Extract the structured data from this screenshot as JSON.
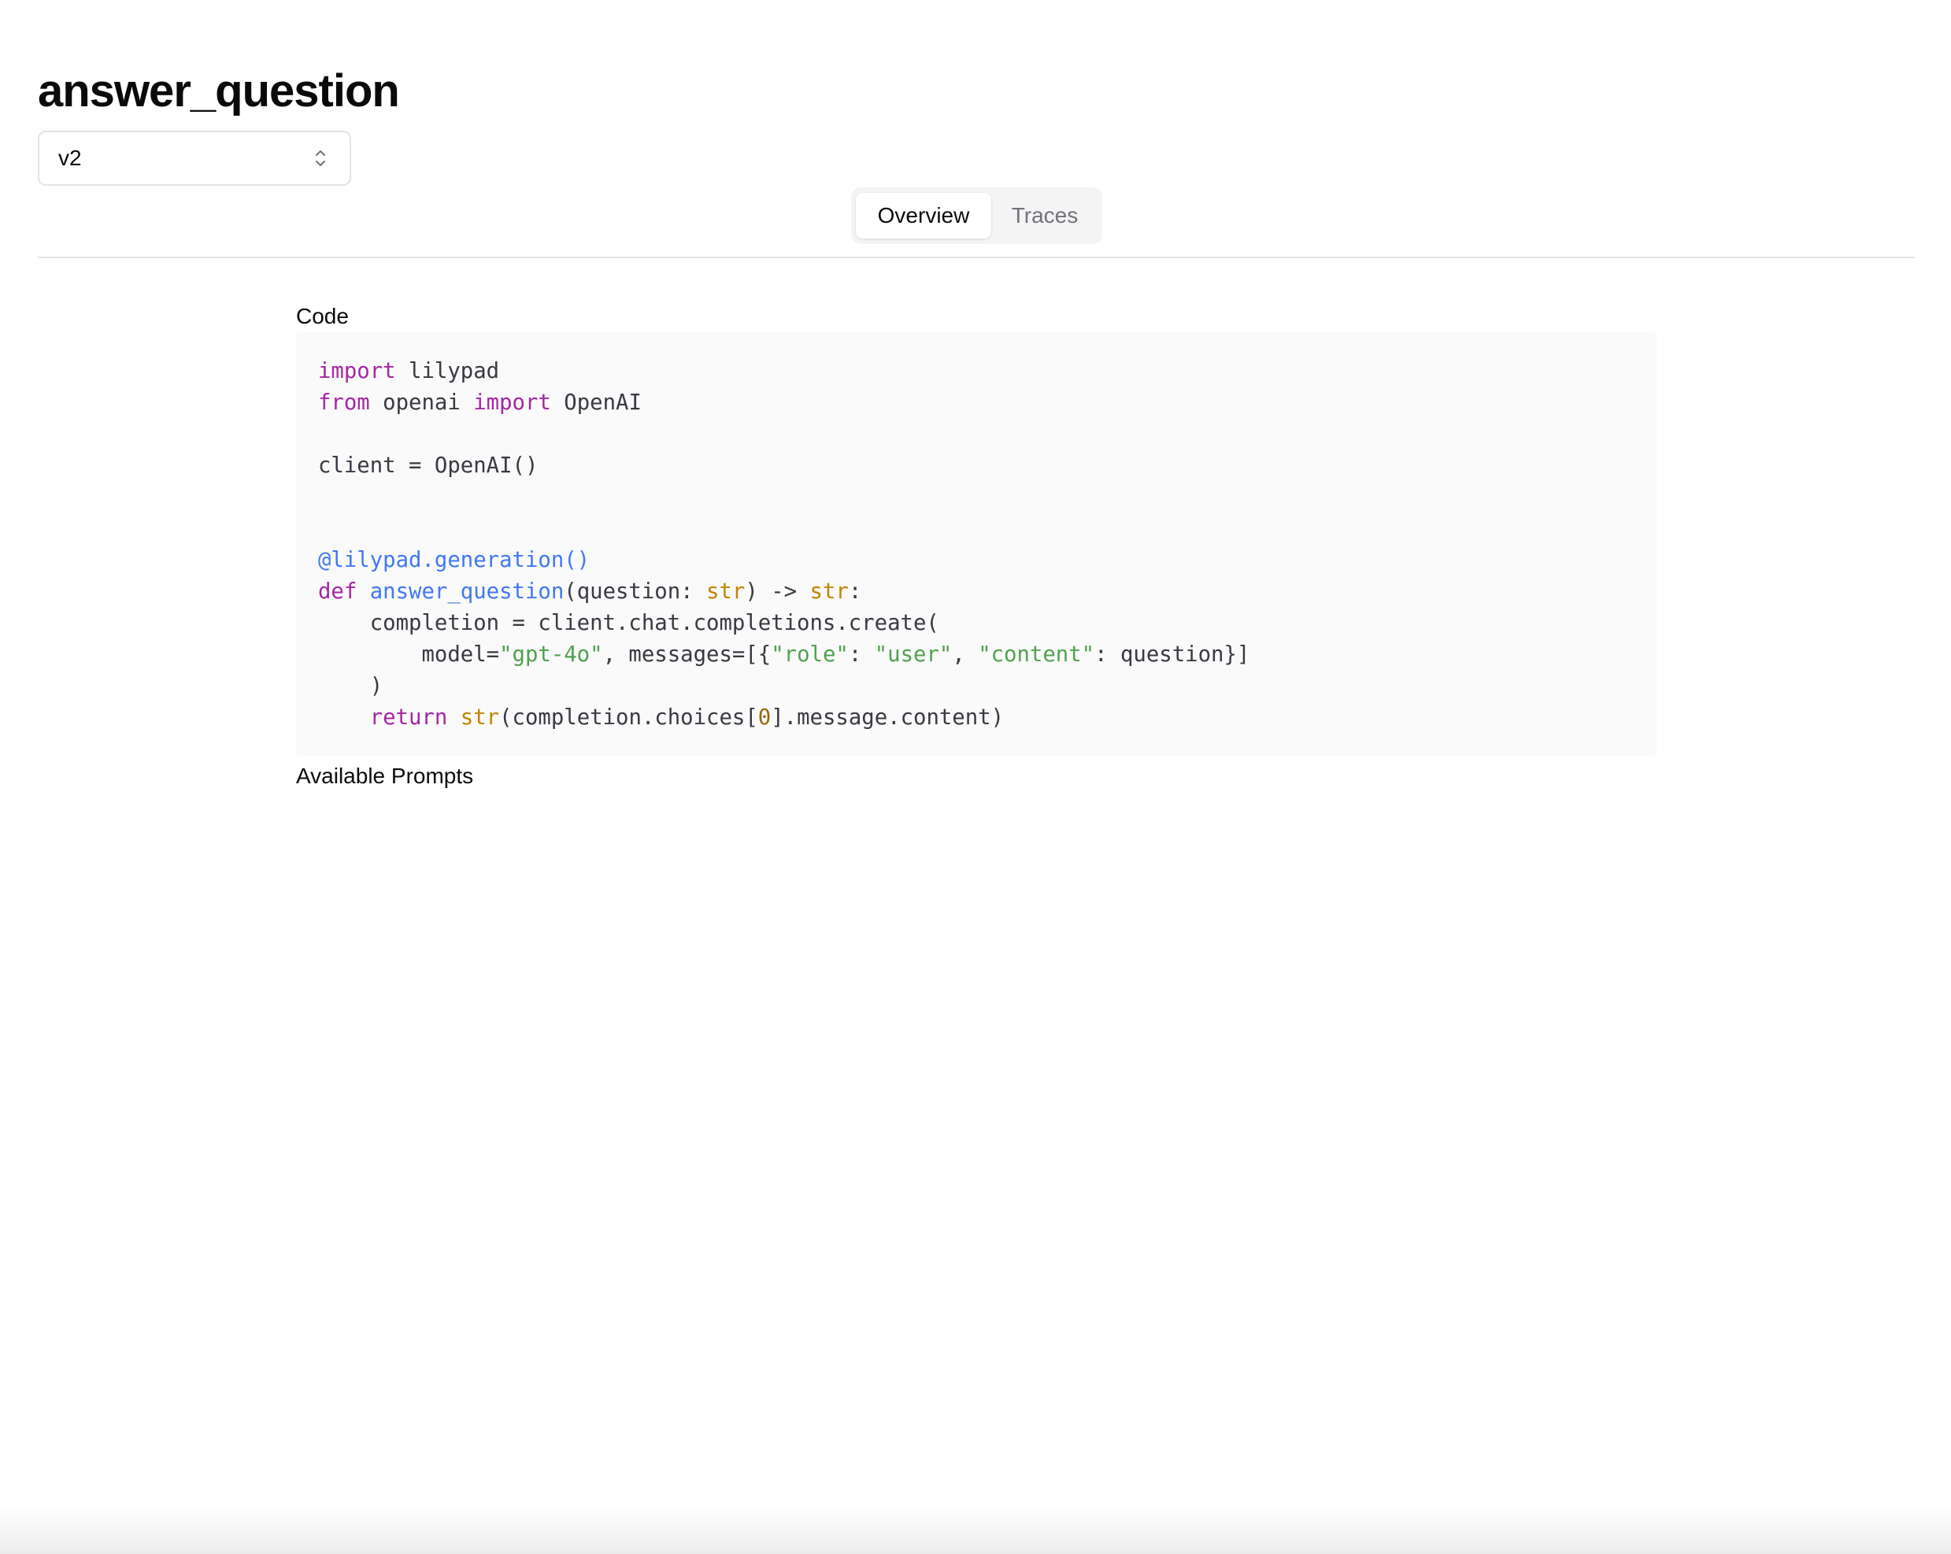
{
  "header": {
    "title": "answer_question"
  },
  "version_select": {
    "value": "v2",
    "icon": "chevron-up-down-icon"
  },
  "tabs": [
    {
      "label": "Overview",
      "active": true
    },
    {
      "label": "Traces",
      "active": false
    }
  ],
  "sections": {
    "code_label": "Code",
    "prompts_label": "Available Prompts"
  },
  "code": {
    "language": "python",
    "lines": [
      "import lilypad",
      "from openai import OpenAI",
      "",
      "client = OpenAI()",
      "",
      "",
      "@lilypad.generation()",
      "def answer_question(question: str) -> str:",
      "    completion = client.chat.completions.create(",
      "        model=\"gpt-4o\", messages=[{\"role\": \"user\", \"content\": question}]",
      "    )",
      "    return str(completion.choices[0].message.content)"
    ]
  },
  "colors": {
    "keyword": "#a626a4",
    "function": "#4078f2",
    "string": "#50a14f",
    "type": "#c18401",
    "number": "#986801",
    "text": "#383a42",
    "code_background": "#fafafa",
    "border": "#e4e4e7",
    "muted_text": "#71717a"
  }
}
